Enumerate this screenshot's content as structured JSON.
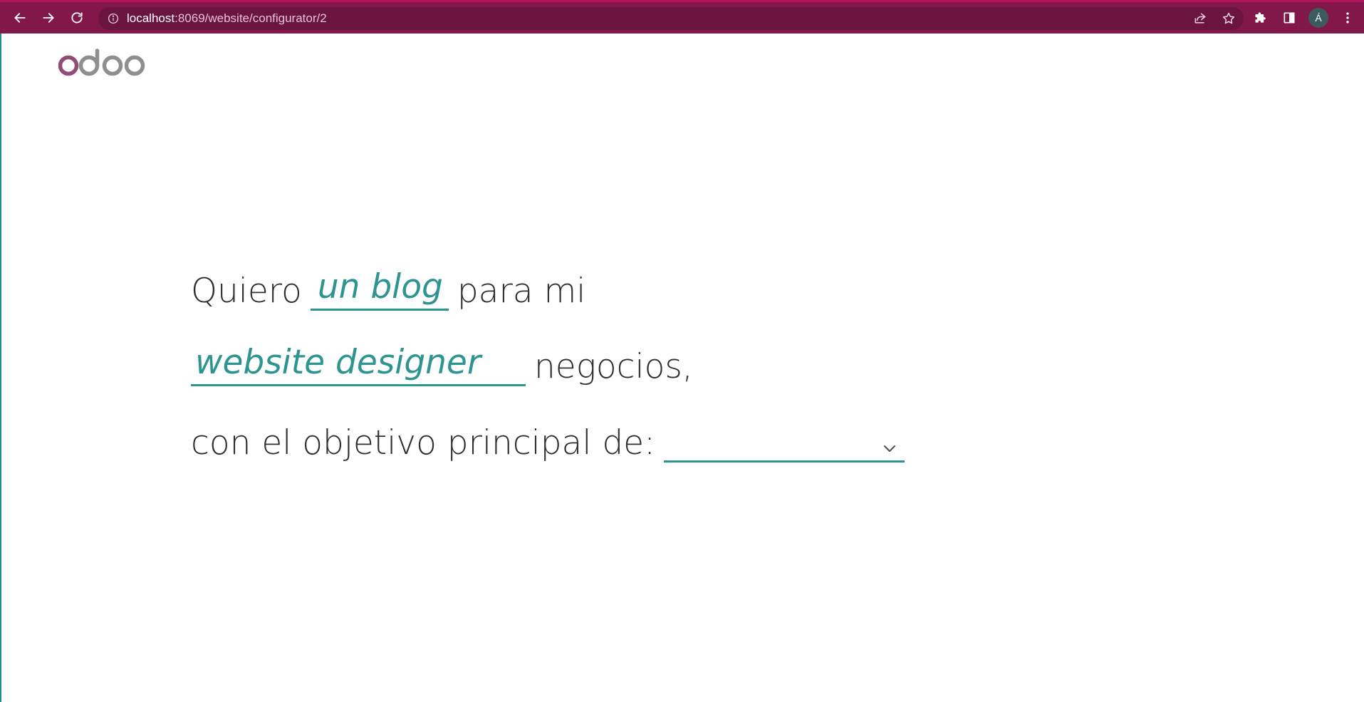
{
  "browser": {
    "url_host": "localhost",
    "url_path": ":8069/website/configurator/2",
    "profile_initial": "Á",
    "accent_color": "#82174a"
  },
  "page": {
    "logo_text": "odoo",
    "line1": {
      "before": "Quiero",
      "website_type": "un blog",
      "after": "para mi"
    },
    "line2": {
      "industry": "website designer",
      "after": "negocios,"
    },
    "line3": {
      "before": "con el objetivo principal de:",
      "objective_selected": ""
    },
    "field_color": "#2e9490",
    "icons": {
      "dropdown": "chevron-down-icon"
    }
  }
}
